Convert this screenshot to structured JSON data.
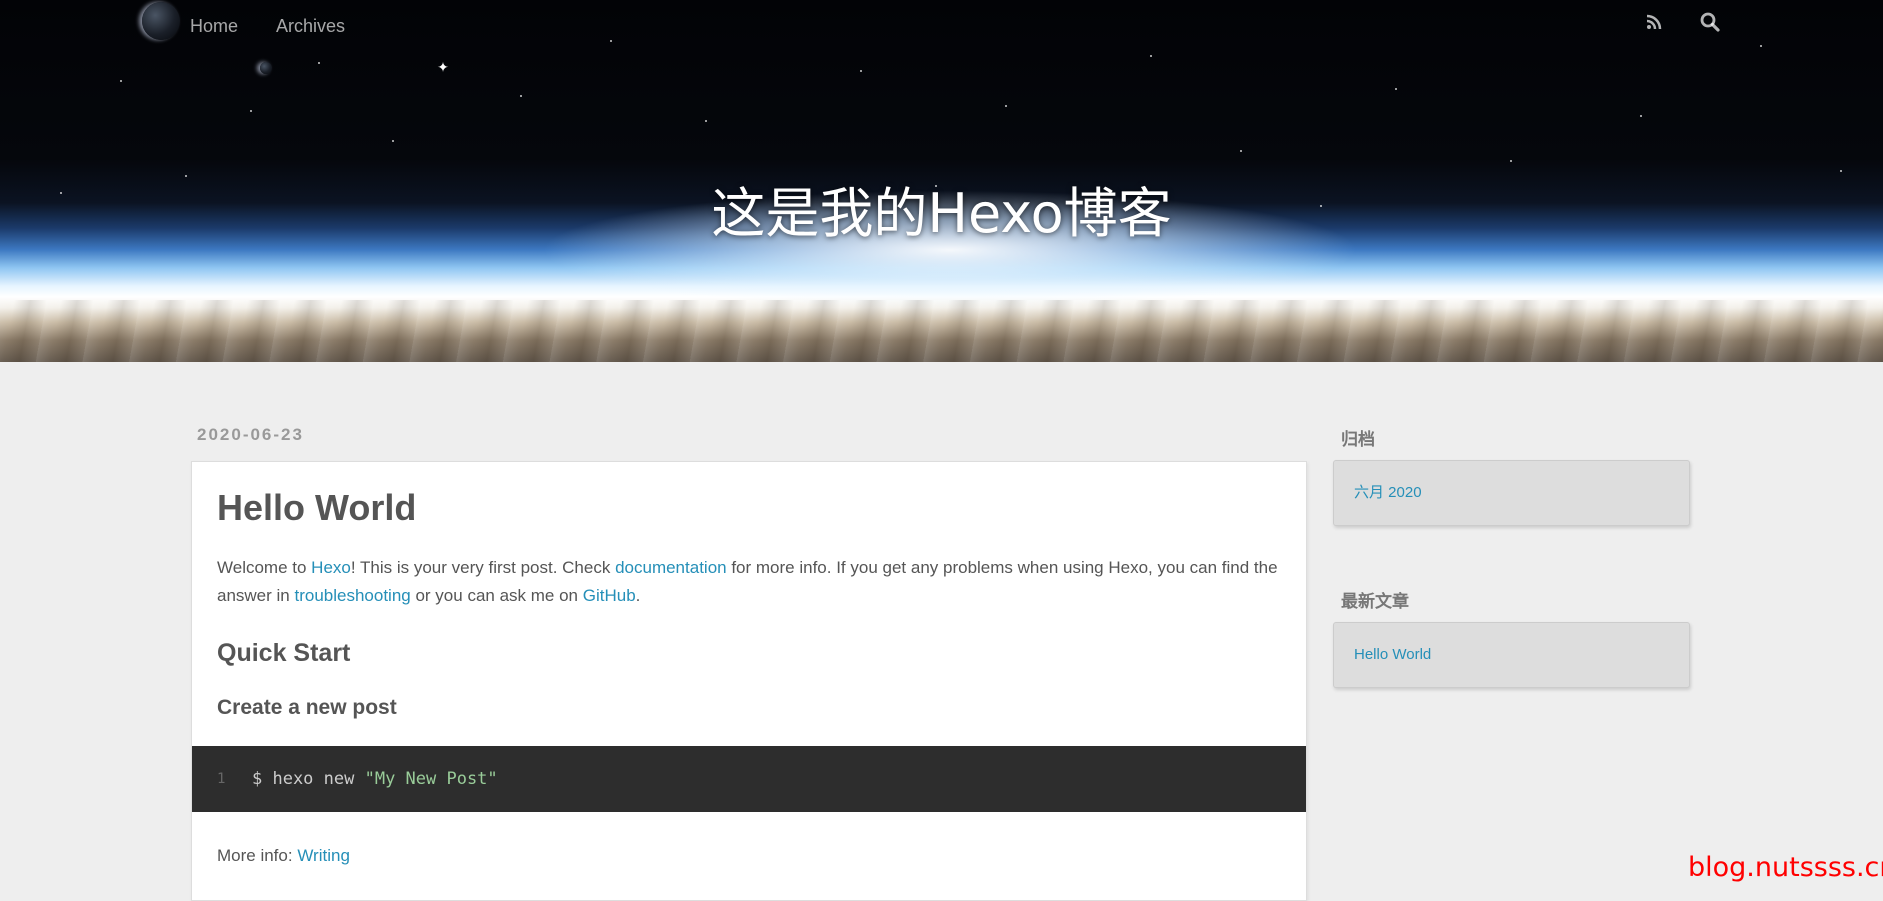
{
  "header": {
    "nav": [
      {
        "label": "Home"
      },
      {
        "label": "Archives"
      }
    ],
    "icons": [
      "rss-icon",
      "search-icon"
    ],
    "site_title": "这是我的Hexo博客"
  },
  "post": {
    "date": "2020-06-23",
    "title": "Hello World",
    "intro": {
      "t1": "Welcome to ",
      "link_hexo": "Hexo",
      "t2": "! This is your very first post. Check ",
      "link_docs": "documentation",
      "t3": " for more info. If you get any problems when using Hexo, you can find the answer in ",
      "link_troubleshooting": "troubleshooting",
      "t4": " or you can ask me on ",
      "link_github": "GitHub",
      "t5": "."
    },
    "heading_quick_start": "Quick Start",
    "heading_create_post": "Create a new post",
    "code": {
      "line_number": "1",
      "command": "$ hexo new ",
      "string": "\"My New Post\""
    },
    "more_info": {
      "label": "More info: ",
      "link": "Writing"
    }
  },
  "sidebar": {
    "archives": {
      "title": "归档",
      "items": [
        "六月 2020"
      ]
    },
    "recent": {
      "title": "最新文章",
      "items": [
        "Hello World"
      ]
    }
  },
  "watermark": "blog.nutssss.cn",
  "colors": {
    "link": "#258fb8",
    "code_bg": "#2d2d2d",
    "code_string": "#99cc99",
    "page_bg": "#eeeeee",
    "watermark": "#ff0000"
  }
}
